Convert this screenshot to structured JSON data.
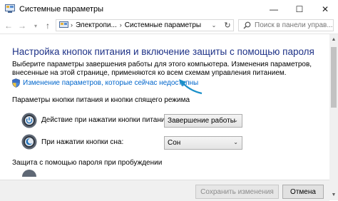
{
  "window": {
    "title": "Системные параметры",
    "minimize_glyph": "—",
    "maximize_glyph": "☐",
    "close_glyph": "✕"
  },
  "nav": {
    "back_glyph": "←",
    "forward_glyph": "→",
    "history_glyph": "▾",
    "up_glyph": "↑",
    "breadcrumbs": [
      "Электропи...",
      "Системные параметры"
    ],
    "separator": "›",
    "refresh_glyph": "↻",
    "dropdown_glyph": "⌄",
    "search_placeholder": "Поиск в панели управ..."
  },
  "content": {
    "heading": "Настройка кнопок питания и включение защиты с помощью пароля",
    "description": "Выберите параметры завершения работы для этого компьютера. Изменения параметров, внесенные на этой странице, применяются ко всем схемам управления питанием.",
    "change_link": "Изменение параметров, которые сейчас недоступны",
    "section_buttons": "Параметры кнопки питания и кнопки спящего режима",
    "power_label": "Действие при нажатии кнопки питания:",
    "power_value": "Завершение работы",
    "sleep_label": "При нажатии кнопки сна:",
    "sleep_value": "Сон",
    "section_password": "Защита с помощью пароля при пробуждении"
  },
  "footer": {
    "save_label": "Сохранить изменения",
    "cancel_label": "Отмена"
  },
  "colors": {
    "heading": "#1e3287",
    "link": "#0066cc",
    "arrow": "#1a8fc9"
  }
}
